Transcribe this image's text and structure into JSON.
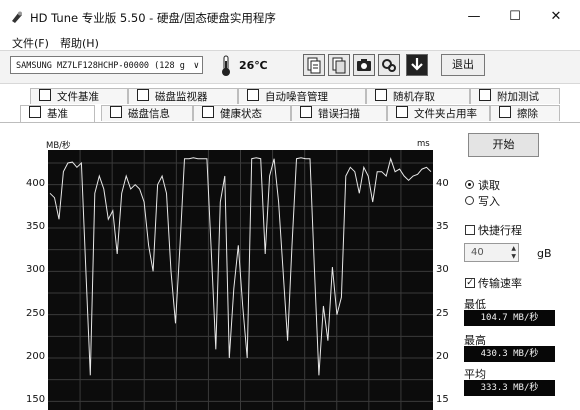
{
  "window": {
    "title": "HD Tune 专业版 5.50 - 硬盘/固态硬盘实用程序",
    "minimize": "—",
    "maximize": "☐",
    "close": "✕"
  },
  "menu": [
    {
      "label": "文件(F)"
    },
    {
      "label": "帮助(H)"
    }
  ],
  "toolbar": {
    "drive": "SAMSUNG MZ7LF128HCHP-00000 (128 g",
    "temperature": "26℃",
    "exit_label": "退出",
    "icons": [
      "thermometer-icon",
      "copy-info-icon",
      "copy-text-icon",
      "camera-icon",
      "settings-icon",
      "download-icon"
    ]
  },
  "tabs_top": [
    {
      "label": "文件基准",
      "icon": "file-benchmark-icon"
    },
    {
      "label": "磁盘监视器",
      "icon": "disk-monitor-icon"
    },
    {
      "label": "自动噪音管理",
      "icon": "speaker-icon"
    },
    {
      "label": "随机存取",
      "icon": "random-access-icon"
    },
    {
      "label": "附加测试",
      "icon": "extra-tests-icon"
    }
  ],
  "tabs_bottom": [
    {
      "label": "基准",
      "icon": "benchmark-icon",
      "active": true
    },
    {
      "label": "磁盘信息",
      "icon": "disk-info-icon"
    },
    {
      "label": "健康状态",
      "icon": "health-icon"
    },
    {
      "label": "错误扫描",
      "icon": "error-scan-icon"
    },
    {
      "label": "文件夹占用率",
      "icon": "folder-usage-icon"
    },
    {
      "label": "擦除",
      "icon": "erase-icon"
    }
  ],
  "chart_data": {
    "type": "line",
    "ylabel_left": "MB/秒",
    "ylabel_right": "ms",
    "yticks_left": [
      400,
      350,
      300,
      250,
      200,
      150
    ],
    "yticks_right": [
      40,
      35,
      30,
      25,
      20,
      15
    ],
    "ylim_left": [
      140,
      440
    ],
    "ylim_right": [
      14,
      44
    ],
    "grid": true,
    "background": "#0c0c0c",
    "line_color": "#e8e8e8",
    "grid_color": "#3a3a3a",
    "series": [
      {
        "values": [
          390,
          385,
          360,
          415,
          425,
          426,
          420,
          425,
          300,
          180,
          390,
          410,
          395,
          360,
          370,
          320,
          390,
          410,
          395,
          400,
          395,
          380,
          330,
          300,
          400,
          410,
          390,
          300,
          240,
          330,
          430,
          430,
          431,
          430,
          430,
          430,
          320,
          210,
          380,
          410,
          200,
          280,
          330,
          260,
          200,
          430,
          431,
          430,
          320,
          410,
          430,
          380,
          300,
          220,
          330,
          430,
          431,
          430,
          430,
          300,
          180,
          260,
          220,
          305,
          250,
          270,
          410,
          420,
          415,
          390,
          420,
          410,
          380,
          415,
          415,
          410,
          430,
          415,
          418,
          410,
          405,
          410,
          412,
          418,
          420,
          415
        ]
      }
    ]
  },
  "side": {
    "start_label": "开始",
    "read_label": "读取",
    "write_label": "写入",
    "short_stroke_label": "快捷行程",
    "short_stroke_value": "40",
    "short_stroke_unit": "gB",
    "transfer_rate_label": "传输速率",
    "min_label": "最低",
    "min_value": "104.7 MB/秒",
    "max_label": "最高",
    "max_value": "430.3 MB/秒",
    "avg_label": "平均",
    "avg_value": "333.3 MB/秒"
  }
}
